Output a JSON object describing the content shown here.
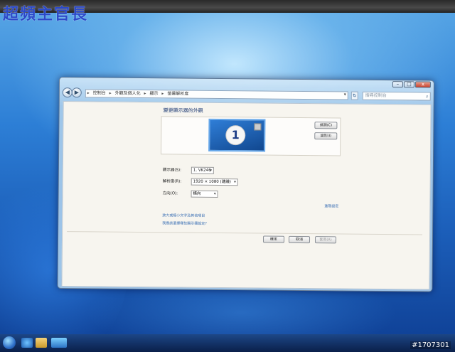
{
  "watermark": "超頻主官長",
  "photo_id": "#1707301",
  "window": {
    "controls": {
      "minimize": "–",
      "maximize": "□",
      "close": "x"
    },
    "nav": {
      "back": "◀",
      "forward": "▶"
    },
    "address": {
      "crumbs": [
        "控制台",
        "外觀及個人化",
        "顯示",
        "螢幕解析度"
      ],
      "separator": "▸",
      "dropdown": "▾",
      "refresh": "↻"
    },
    "search": {
      "placeholder": "搜尋控制台",
      "icon": "search-icon"
    },
    "content": {
      "title": "變更顯示器的外觀",
      "monitor_number": "1",
      "detect_label": "偵測(C)",
      "identify_label": "識別(I)",
      "display_label": "顯示器(S):",
      "display_value": "1. VK246",
      "resolution_label": "解析度(R):",
      "resolution_value": "1920 × 1080 (建議)",
      "orientation_label": "方向(O):",
      "orientation_value": "橫向",
      "select_arrow": "▾",
      "advanced_link": "進階設定",
      "link_text_size": "放大或縮小文字及其他項目",
      "link_which_settings": "我應該選擇哪些顯示器設定?",
      "ok_label": "確定",
      "cancel_label": "取消",
      "apply_label": "套用(A)"
    }
  }
}
